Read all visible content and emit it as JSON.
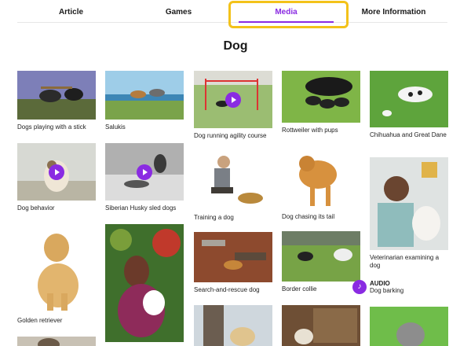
{
  "tabs": [
    {
      "label": "Article"
    },
    {
      "label": "Games"
    },
    {
      "label": "Media"
    },
    {
      "label": "More Information"
    }
  ],
  "page_title": "Dog",
  "media": {
    "dogs_stick": "Dogs playing with a stick",
    "salukis": "Salukis",
    "agility": "Dog running agility course",
    "rottweiler": "Rottweiler with pups",
    "chihuahua": "Chihuahua and Great Dane",
    "behavior": "Dog behavior",
    "husky": "Siberian Husky sled dogs",
    "training": "Training a dog",
    "chasing_tail": "Dog chasing its tail",
    "veterinarian": "Veterinarian examining a dog",
    "golden": "Golden retriever",
    "rescue": "Search-and-rescue dog",
    "border_collie": "Border collie"
  },
  "audio": {
    "label": "AUDIO",
    "title": "Dog barking",
    "icon": "music-note-icon"
  },
  "colors": {
    "accent": "#8a2be2",
    "highlight": "#f3c21a"
  }
}
